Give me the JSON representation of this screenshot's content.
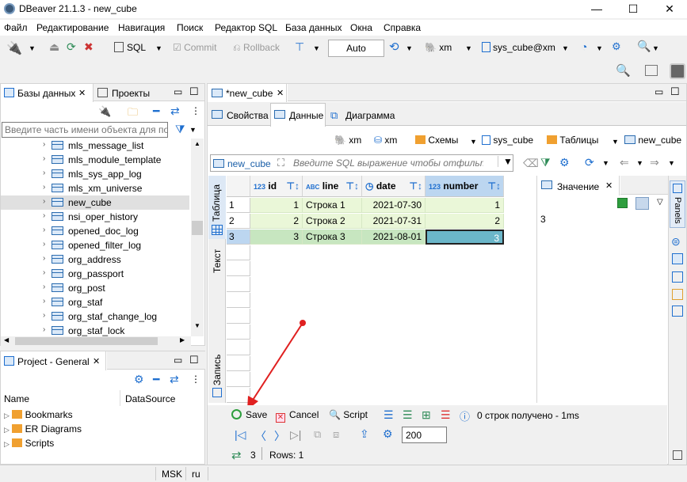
{
  "window": {
    "title": "DBeaver 21.1.3 - new_cube"
  },
  "menu": [
    "Файл",
    "Редактирование",
    "Навигация",
    "Поиск",
    "Редактор SQL",
    "База данных",
    "Окна",
    "Справка"
  ],
  "toolbar": {
    "sql_label": "SQL",
    "commit_label": "Commit",
    "rollback_label": "Rollback",
    "tx_mode": "Auto",
    "db_label": "xm",
    "connection_label": "sys_cube@xm"
  },
  "left_panel": {
    "tab_databases": "Базы данных",
    "tab_projects": "Проекты",
    "filter_placeholder": "Введите часть имени объекта для пои",
    "tables": [
      "mls_message_list",
      "mls_module_template",
      "mls_sys_app_log",
      "mls_xm_universe",
      "new_cube",
      "nsi_oper_history",
      "opened_doc_log",
      "opened_filter_log",
      "org_address",
      "org_passport",
      "org_post",
      "org_staf",
      "org_staf_change_log",
      "org_staf_lock"
    ],
    "selected_table": "new_cube"
  },
  "project_panel": {
    "tab": "Project - General",
    "col_name": "Name",
    "col_datasource": "DataSource",
    "items": [
      "Bookmarks",
      "ER Diagrams",
      "Scripts"
    ]
  },
  "editor": {
    "tab_title": "*new_cube",
    "subtabs": [
      "Свойства",
      "Данные",
      "Диаграмма"
    ],
    "active_subtab": "Данные",
    "breadcrumb": [
      "xm",
      "xm",
      "Схемы",
      "sys_cube",
      "Таблицы",
      "new_cube"
    ],
    "filter_table": "new_cube",
    "filter_placeholder": "Введите SQL выражение чтобы отфильт",
    "side_tabs": [
      "Таблица",
      "Текст",
      "Запись"
    ]
  },
  "grid": {
    "columns": [
      {
        "name": "id",
        "type_icon": "123"
      },
      {
        "name": "line",
        "type_icon": "ABC"
      },
      {
        "name": "date",
        "type_icon": "clock"
      },
      {
        "name": "number",
        "type_icon": "123"
      }
    ],
    "rows": [
      {
        "n": "1",
        "id": "1",
        "line": "Строка 1",
        "date": "2021-07-30",
        "number": "1"
      },
      {
        "n": "2",
        "id": "2",
        "line": "Строка 2",
        "date": "2021-07-31",
        "number": "2"
      },
      {
        "n": "3",
        "id": "3",
        "line": "Строка 3",
        "date": "2021-08-01",
        "number": "3"
      }
    ],
    "selected_row": 3
  },
  "value_panel": {
    "title": "Значение",
    "value": "3",
    "side_tab": "Panels"
  },
  "actions": {
    "save": "Save",
    "cancel": "Cancel",
    "script": "Script",
    "status": "0 строк получено - 1ms",
    "fetch_size": "200",
    "row_count": "3",
    "rows_label": "Rows: 1"
  },
  "statusbar": {
    "timezone": "MSK",
    "locale": "ru"
  },
  "colors": {
    "accent": "#1f6fcf",
    "selected_row": "#c7e6c0",
    "edited_cell": "#eaf7d8",
    "selected_cell": "#6bb6c9",
    "annotation_arrow": "#e02020"
  }
}
